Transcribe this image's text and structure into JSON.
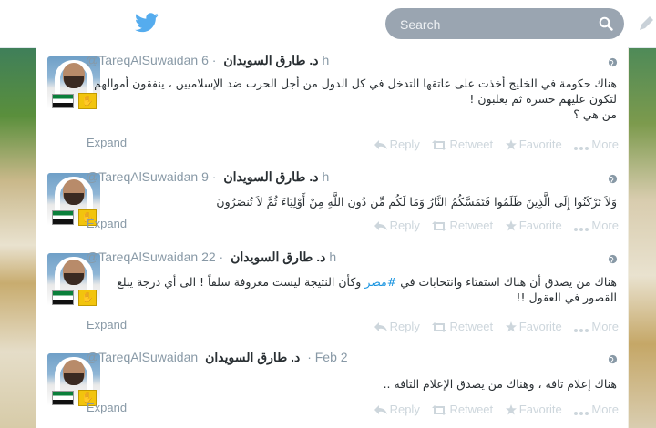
{
  "search": {
    "placeholder": "Search"
  },
  "colors": {
    "brand": "#55acee",
    "link": "#1b95e0",
    "muted": "#8899a6",
    "action": "#cdd6dc",
    "text": "#292f33"
  },
  "tweets": [
    {
      "handle": "@TareqAlSuwaidan",
      "name": "د. طارق السويدان",
      "time": "6h",
      "text_lines": [
        "هناك حكومة في الخليج أخذت على عاتقها التدخل في كل الدول من أجل الحرب ضد الإسلاميين ، ينفقون أموالهم",
        "لتكون عليهم حسرة ثم يغلبون !",
        "من هي ؟"
      ],
      "expand": "Expand",
      "reply": "Reply",
      "retweet": "Retweet",
      "favorite": "Favorite",
      "more": "More"
    },
    {
      "handle": "@TareqAlSuwaidan",
      "name": "د. طارق السويدان",
      "time": "9h",
      "text_lines": [
        "وَلاَ تَرْكَنُوا إِلَى الَّذِينَ ظَلَمُوا فَتَمَسَّكُمُ النَّارُ وَمَا لَكُم مِّن دُونِ اللَّهِ مِنْ أَوْلِيَاءَ ثُمَّ لاَ تُنصَرُونَ"
      ],
      "expand": "Expand",
      "reply": "Reply",
      "retweet": "Retweet",
      "favorite": "Favorite",
      "more": "More"
    },
    {
      "handle": "@TareqAlSuwaidan",
      "name": "د. طارق السويدان",
      "time": "22h",
      "text_pre": "هناك من يصدق أن هناك استفتاء وانتخابات في ",
      "hashtag": "#مصر",
      "text_post": " وكأن النتيجة ليست معروفة سلفاً ! الى أي درجة يبلغ",
      "text_line2": "القصور في العقول !!",
      "expand": "Expand",
      "reply": "Reply",
      "retweet": "Retweet",
      "favorite": "Favorite",
      "more": "More"
    },
    {
      "handle": "@TareqAlSuwaidan",
      "name": "د. طارق السويدان",
      "time": "Feb 2",
      "text_lines": [
        "هناك إعلام تافه ، وهناك من يصدق الإعلام التافه .."
      ],
      "expand": "Expand",
      "reply": "Reply",
      "retweet": "Retweet",
      "favorite": "Favorite",
      "more": "More"
    }
  ]
}
